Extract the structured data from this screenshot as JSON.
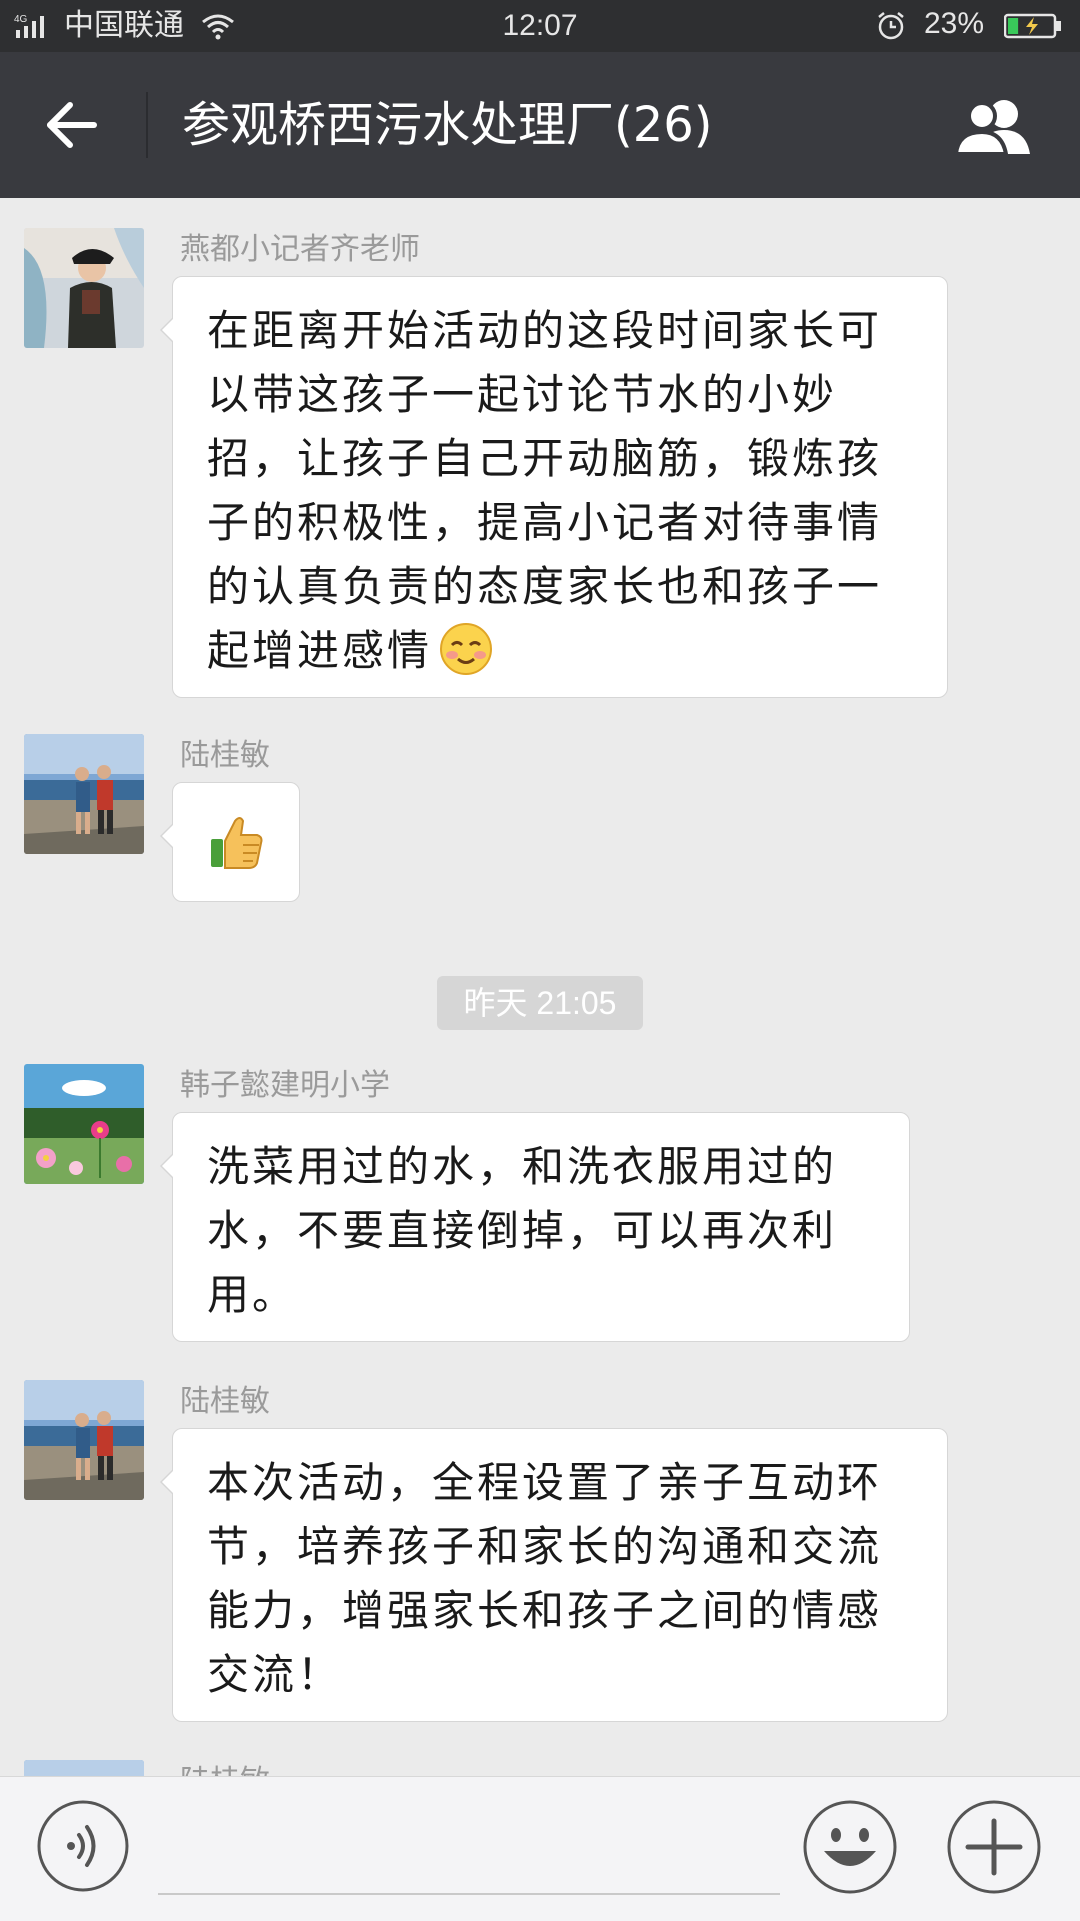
{
  "status_bar": {
    "network_type": "4G",
    "carrier": "中国联通",
    "time": "12:07",
    "battery_percent": "23%",
    "battery_level": 0.23,
    "icons": [
      "signal-icon",
      "wifi-icon",
      "alarm-icon",
      "battery-charging-icon"
    ]
  },
  "header": {
    "title": "参观桥西污水处理厂(26)",
    "back_icon": "arrow-left-icon",
    "group_icon": "group-members-icon",
    "background_color": "#393a3f"
  },
  "messages": [
    {
      "sender": "燕都小记者齐老师",
      "text": "在距离开始活动的这段时间家长可以带这孩子一起讨论节水的小妙招，让孩子自己开动脑筋，锻炼孩子的积极性，提高小记者对待事情的认真负责的态度家长也和孩子一起增进感情",
      "emoji": "smiling-face-icon"
    },
    {
      "sender": "陆桂敏",
      "emoji": "thumbs-up-icon"
    },
    {
      "timestamp": "昨天 21:05"
    },
    {
      "sender": "韩子懿建明小学",
      "text": "洗菜用过的水，和洗衣服用过的水，不要直接倒掉，可以再次利用。"
    },
    {
      "sender": "陆桂敏",
      "text": "本次活动，全程设置了亲子互动环节，培养孩子和家长的沟通和交流能力，增强家长和孩子之间的情感交流！"
    },
    {
      "sender": "陆桂敏"
    }
  ],
  "input_bar": {
    "voice_icon": "voice-input-icon",
    "emoji_icon": "emoji-icon",
    "more_icon": "plus-icon",
    "text_value": ""
  },
  "colors": {
    "chat_background": "#ebebeb",
    "bubble_background": "#ffffff",
    "sender_name": "#9a9a9a",
    "timestamp_background": "#d6d6d6",
    "battery_charge": "#39c95a"
  }
}
